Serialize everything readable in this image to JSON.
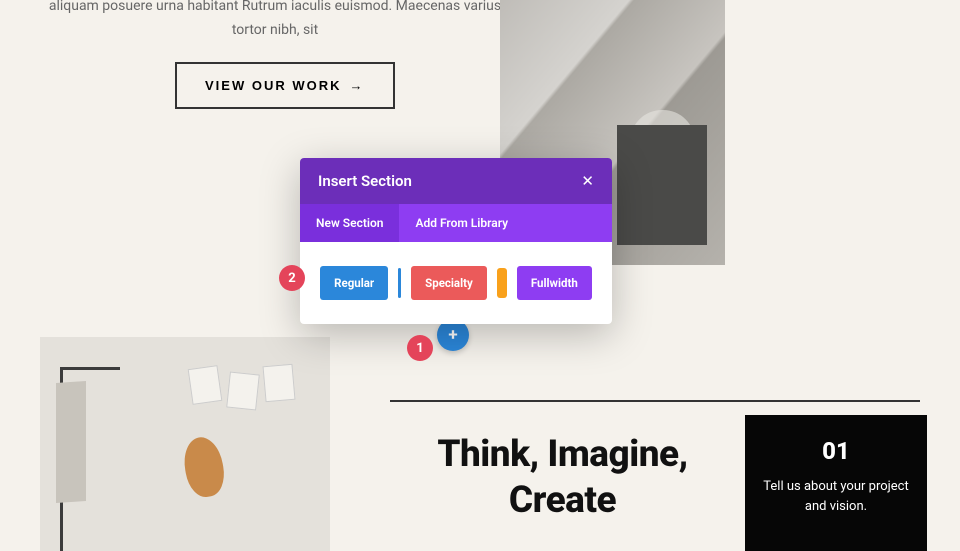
{
  "hero": {
    "text": "aliquam posuere urna habitant Rutrum iaculis euismod. Maecenas varius tortor nibh, sit",
    "cta_label": "VIEW OUR WORK",
    "cta_arrow": "→"
  },
  "modal": {
    "title": "Insert Section",
    "close": "✕",
    "tabs": {
      "new": "New Section",
      "library": "Add From Library"
    },
    "options": {
      "regular": "Regular",
      "specialty": "Specialty",
      "fullwidth": "Fullwidth"
    }
  },
  "markers": {
    "one": "1",
    "two": "2"
  },
  "add_button": "+",
  "headline": "Think, Imagine, Create",
  "step": {
    "number": "01",
    "text": "Tell us about your project and vision."
  }
}
